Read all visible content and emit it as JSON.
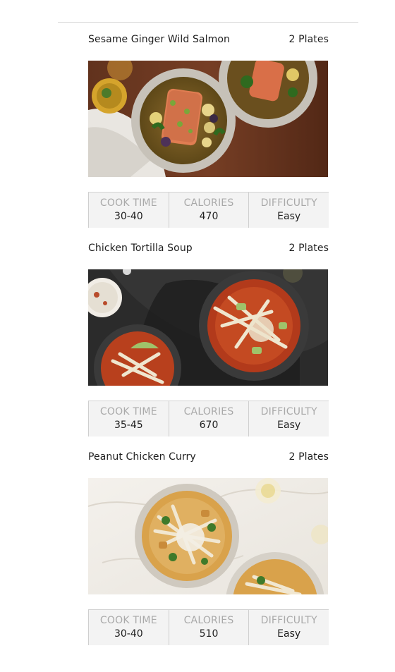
{
  "recipes": [
    {
      "title": "Sesame Ginger Wild Salmon",
      "servings": "2 Plates",
      "image_icon": "salmon-bowl-photo",
      "stats": [
        {
          "label": "COOK TIME",
          "value": "30-40"
        },
        {
          "label": "CALORIES",
          "value": "470"
        },
        {
          "label": "DIFFICULTY",
          "value": "Easy"
        }
      ]
    },
    {
      "title": "Chicken Tortilla Soup",
      "servings": "2 Plates",
      "image_icon": "tortilla-soup-photo",
      "stats": [
        {
          "label": "COOK TIME",
          "value": "35-45"
        },
        {
          "label": "CALORIES",
          "value": "670"
        },
        {
          "label": "DIFFICULTY",
          "value": "Easy"
        }
      ]
    },
    {
      "title": "Peanut Chicken Curry",
      "servings": "2 Plates",
      "image_icon": "curry-bowl-photo",
      "stats": [
        {
          "label": "COOK TIME",
          "value": "30-40"
        },
        {
          "label": "CALORIES",
          "value": "510"
        },
        {
          "label": "DIFFICULTY",
          "value": "Easy"
        }
      ]
    }
  ],
  "colors": {
    "stat_label": "#a9a9a9",
    "stat_bg": "#f3f3f3",
    "text": "#1f1f1f"
  }
}
